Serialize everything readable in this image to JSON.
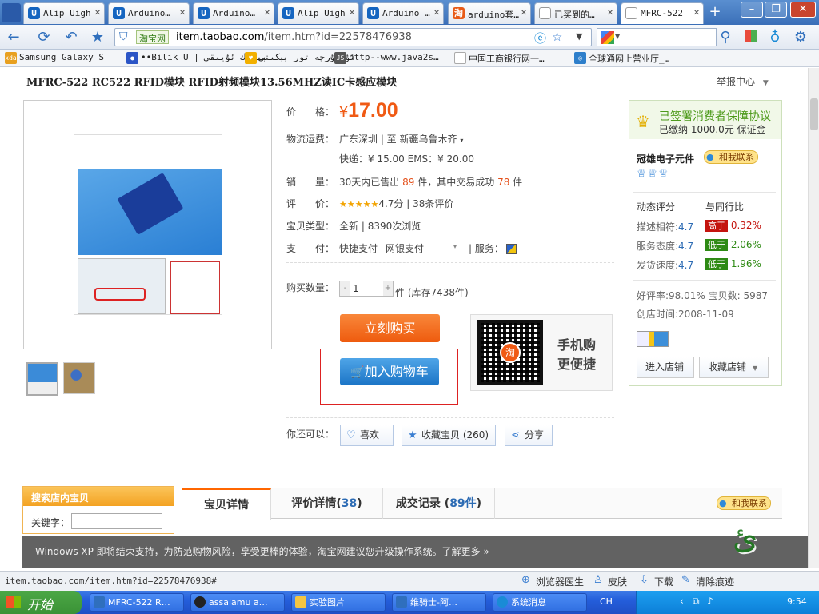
{
  "browser": {
    "tabs": [
      {
        "label": "Alip Uigh",
        "icon": "U"
      },
      {
        "label": "Arduino…",
        "icon": "U"
      },
      {
        "label": "Arduino…",
        "icon": "U"
      },
      {
        "label": "Alip Uigh",
        "icon": "U"
      },
      {
        "label": "Arduino …",
        "icon": "U"
      },
      {
        "label": "arduino套…",
        "icon": "淘"
      },
      {
        "label": "已买到的…",
        "icon": ""
      },
      {
        "label": "MFRC-522",
        "icon": ""
      }
    ],
    "new_tab": "+",
    "address": {
      "tag": "淘宝网",
      "url_host": "item.taobao.com",
      "url_path": "/item.htm?id=22578476938"
    },
    "bookmarks": [
      {
        "label": "Samsung Galaxy S",
        "icon": "xda",
        "color": "#e8a020"
      },
      {
        "label": "••Bilik U | بىلىك ئۇيىقى",
        "icon": "●",
        "color": "#2b55c6"
      },
      {
        "label": "ئۇيغۇرچە تور بېكىتى",
        "icon": "♥",
        "color": "#f2b000"
      },
      {
        "label": "http--www.java2s…",
        "icon": "JS",
        "color": "#555"
      },
      {
        "label": "中国工商银行网一…",
        "icon": "",
        "color": "#ddd"
      },
      {
        "label": "全球通网上营业厅_…",
        "icon": "◎",
        "color": "#2e7fcb"
      }
    ]
  },
  "product": {
    "title": "MFRC-522 RC522 RFID模块 RFID射频模块13.56MHZ读IC卡感应模块",
    "report": "举报中心",
    "price_label": "价　　格：",
    "price_symbol": "¥",
    "price": "17.00",
    "shipping_label": "物流运费：",
    "shipping_route": "广东深圳 | 至  新疆乌鲁木齐",
    "shipping_cost": "快递：¥ 15.00   EMS：¥ 20.00",
    "sales_label": "销　　量：",
    "sales_pre": "30天内已售出",
    "sales_count": "89",
    "sales_mid": "件，其中交易成功",
    "sales_success": "78",
    "sales_unit": "件",
    "rating_label": "评　　价：",
    "rating_stars": "★★★★★",
    "rating_score": "4.7分",
    "rating_count": "38条评价",
    "type_label": "宝贝类型：",
    "type_value": "全新",
    "views": "8390次浏览",
    "pay_label": "支　　付：",
    "pay_quick": "快捷支付",
    "pay_bank": "网银支付",
    "service_label": "服务：",
    "qty_label": "购买数量：",
    "qty_value": "1",
    "qty_unit": "件 (库存7438件)",
    "buy_now": "立刻购买",
    "add_cart": "加入购物车",
    "qr_text1": "手机购",
    "qr_text2": "更便捷",
    "qr_logo": "淘",
    "also_label": "你还可以：",
    "like": "喜欢",
    "collect": "收藏宝贝 (260)",
    "share": "分享"
  },
  "shop": {
    "guarantee": "已签署消费者保障协议",
    "deposit": "已缴纳 1000.0元 保证金",
    "name": "冠雄电子元件",
    "contact": "和我联系",
    "dynamic_label": "动态评分",
    "compare_label": "与同行比",
    "scores": [
      {
        "label": "描述相符:",
        "score": "4.7",
        "badge": "高于",
        "pct": "0.32%",
        "dir": "up"
      },
      {
        "label": "服务态度:",
        "score": "4.7",
        "badge": "低于",
        "pct": "2.06%",
        "dir": "down"
      },
      {
        "label": "发货速度:",
        "score": "4.7",
        "badge": "低于",
        "pct": "1.96%",
        "dir": "down"
      }
    ],
    "good_rate": "好评率:98.01%",
    "item_count": "宝贝数: 5987",
    "open_date": "创店时间:2008-11-09",
    "enter_shop": "进入店铺",
    "fav_shop": "收藏店铺"
  },
  "lower": {
    "search_title": "搜索店内宝贝",
    "keyword_label": "关键字：",
    "tab_detail": "宝贝详情",
    "tab_review": "评价详情",
    "tab_review_count": "38",
    "tab_record": "成交记录",
    "tab_record_count": "89件",
    "contact": "和我联系",
    "xp_notice": "Windows XP 即将结束支持，为防范购物风险，享受更棒的体验，淘宝网建议您升级操作系统。了解更多 »"
  },
  "status": {
    "url": "item.taobao.com/item.htm?id=22578476938#",
    "doctor": "浏览器医生",
    "skin": "皮肤",
    "download": "下载",
    "clean": "清除痕迹"
  },
  "taskbar": {
    "start": "开始",
    "tasks": [
      "MFRC-522 R…",
      "assalamu a…",
      "实验图片",
      "维骑士-阿…",
      "系统消息"
    ],
    "ime": "CH",
    "clock": "9:54"
  },
  "colors": {
    "price": "#f05a14",
    "accent": "#3b6fb8",
    "cart": "#1b74c6",
    "buy": "#ee5b0e"
  }
}
